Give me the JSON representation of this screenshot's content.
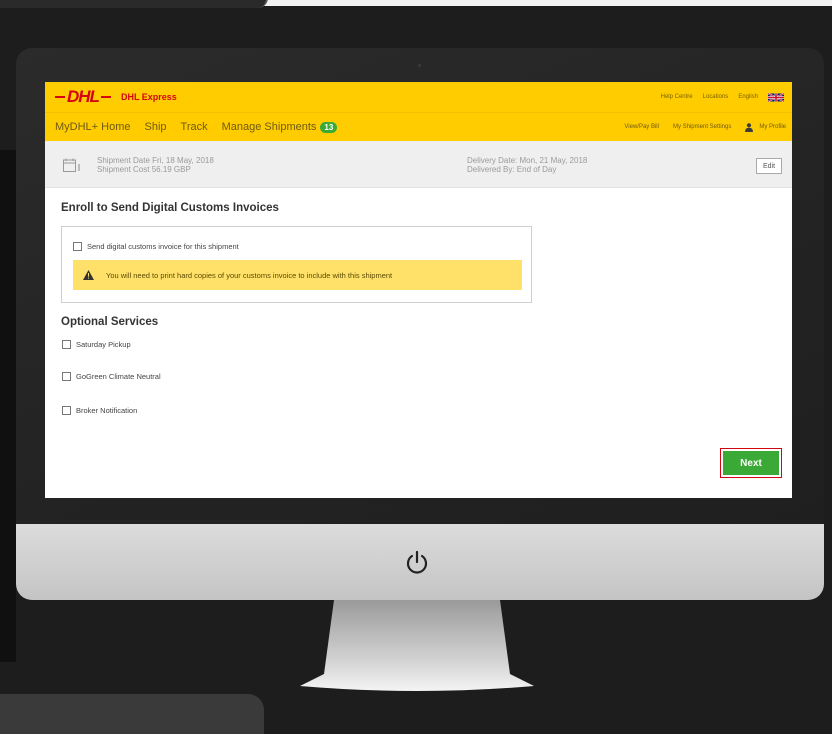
{
  "app": {
    "brand_logo": "DHL",
    "brand_name": "DHL Express"
  },
  "top_links": {
    "help": "Help Centre",
    "locations": "Locations",
    "language": "English",
    "flag": "uk-flag-icon"
  },
  "nav": {
    "home": "MyDHL+ Home",
    "ship": "Ship",
    "track": "Track",
    "manage": "Manage Shipments",
    "manage_badge": "13",
    "view_pay": "View/Pay Bill",
    "settings": "My Shipment Settings",
    "profile": "My Profile"
  },
  "summary": {
    "shipment_date": "Shipment Date Fri, 18 May, 2018",
    "shipment_cost": "Shipment Cost 56.19 GBP",
    "delivery_date": "Delivery Date: Mon, 21 May, 2018",
    "delivered_by": "Delivered By: End of Day",
    "edit_label": "Edit"
  },
  "enroll": {
    "title": "Enroll to Send Digital Customs Invoices",
    "checkbox_label": "Send digital customs invoice for this shipment",
    "warning": "You will need to print hard copies of your customs invoice to include with this shipment"
  },
  "optional": {
    "title": "Optional Services",
    "items": [
      {
        "label": "Saturday Pickup"
      },
      {
        "label": "GoGreen Climate Neutral"
      },
      {
        "label": "Broker Notification"
      }
    ]
  },
  "actions": {
    "next_label": "Next"
  },
  "colors": {
    "brand_yellow": "#ffcc00",
    "brand_red": "#d40511",
    "next_green": "#3aa935",
    "warning_yellow": "#ffe16a"
  }
}
